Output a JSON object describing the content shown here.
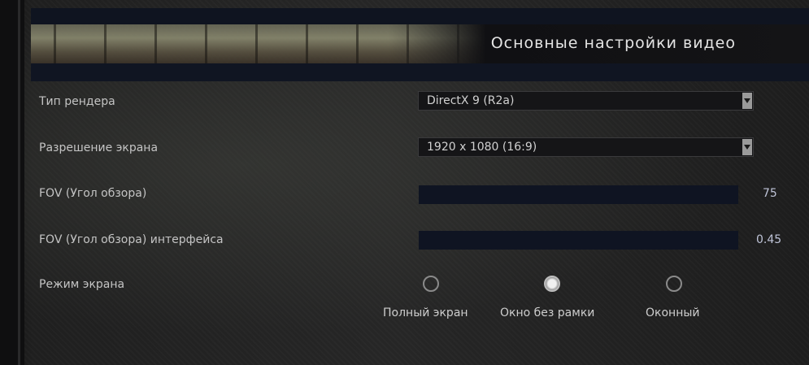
{
  "header": {
    "title": "Основные настройки видео"
  },
  "settings": {
    "render": {
      "label": "Тип рендера",
      "value": "DirectX 9 (R2a)"
    },
    "resolution": {
      "label": "Разрешение экрана",
      "value": "1920 x 1080 (16:9)"
    },
    "fov": {
      "label": "FOV (Угол обзора)",
      "value": "75"
    },
    "hud_fov": {
      "label": "FOV (Угол обзора) интерфейса",
      "value": "0.45"
    },
    "screen_mode": {
      "label": "Режим экрана",
      "options": [
        {
          "label": "Полный экран",
          "selected": false
        },
        {
          "label": "Окно без рамки",
          "selected": true
        },
        {
          "label": "Оконный",
          "selected": false
        }
      ]
    }
  }
}
